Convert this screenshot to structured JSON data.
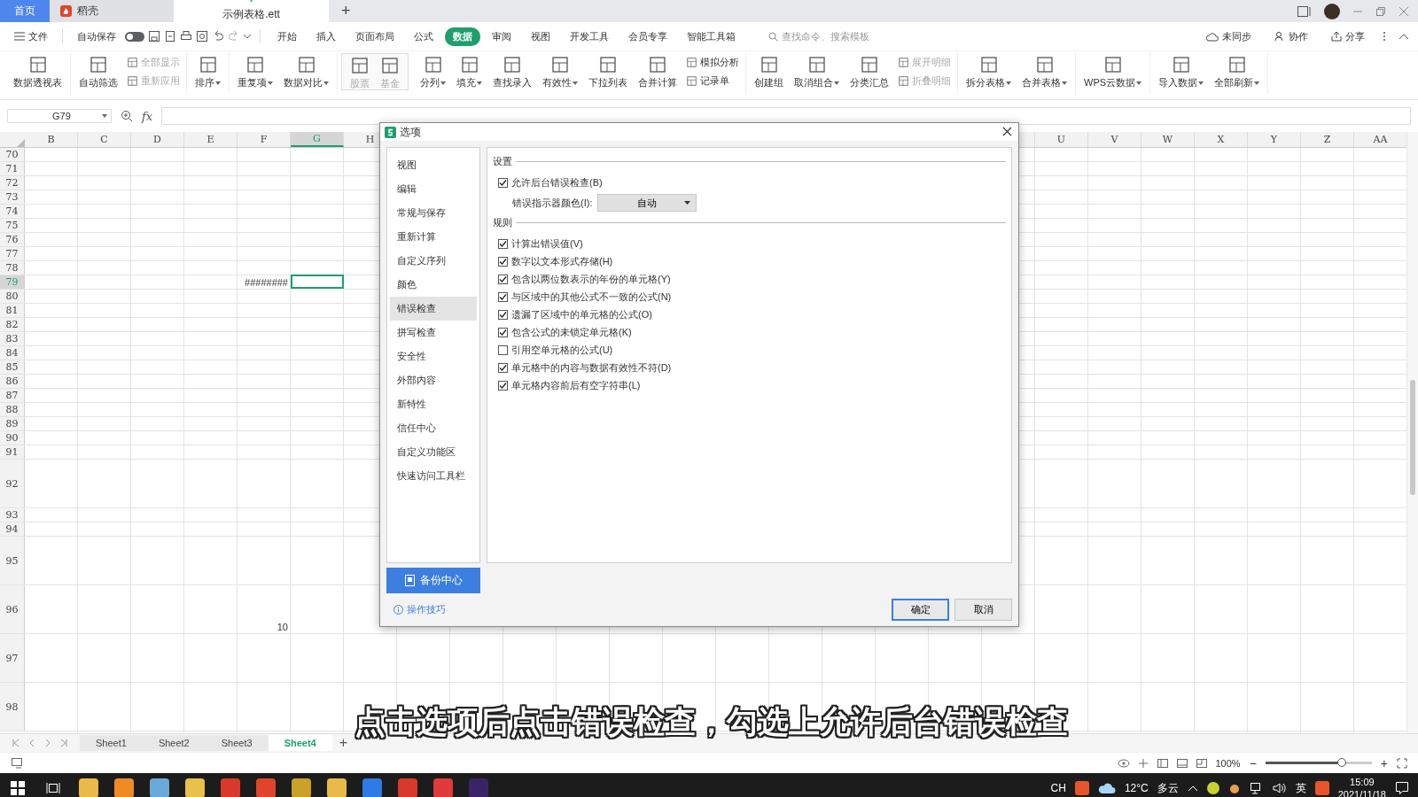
{
  "title_bar": {
    "tabs": [
      {
        "label": "首页",
        "kind": "home",
        "selected": false
      },
      {
        "label": "稻壳",
        "kind": "docer",
        "selected": false
      },
      {
        "label": "示例表格.ett",
        "kind": "sheet",
        "selected": true
      }
    ],
    "new_tab": "+"
  },
  "menu_bar": {
    "file": "文件",
    "autosave": {
      "label": "自动保存",
      "on": false
    },
    "tabs": [
      {
        "label": "开始",
        "selected": false
      },
      {
        "label": "插入",
        "selected": false
      },
      {
        "label": "页面布局",
        "selected": false
      },
      {
        "label": "公式",
        "selected": false
      },
      {
        "label": "数据",
        "selected": true
      },
      {
        "label": "审阅",
        "selected": false
      },
      {
        "label": "视图",
        "selected": false
      },
      {
        "label": "开发工具",
        "selected": false
      },
      {
        "label": "会员专享",
        "selected": false
      },
      {
        "label": "智能工具箱",
        "selected": false
      }
    ],
    "search": {
      "placeholder": "查找命令、搜索模板"
    },
    "actions": [
      "未同步",
      "协作",
      "分享"
    ]
  },
  "ribbon": {
    "groups": [
      {
        "kind": "plain",
        "items": [
          {
            "kind": "large",
            "label": "数据透视表",
            "dropdown": false,
            "disabled": false
          }
        ]
      },
      {
        "kind": "plain",
        "items": [
          {
            "kind": "large",
            "label": "自动筛选",
            "dropdown": false,
            "disabled": false
          },
          {
            "kind": "stack",
            "items": [
              {
                "label": "全部显示",
                "disabled": true
              },
              {
                "label": "重新应用",
                "disabled": true
              }
            ]
          }
        ]
      },
      {
        "kind": "plain",
        "items": [
          {
            "kind": "large",
            "label": "排序",
            "dropdown": true,
            "disabled": false
          }
        ]
      },
      {
        "kind": "plain",
        "items": [
          {
            "kind": "large",
            "label": "重复项",
            "dropdown": true,
            "disabled": false
          },
          {
            "kind": "large",
            "label": "数据对比",
            "dropdown": true,
            "disabled": false
          }
        ]
      },
      {
        "kind": "gallery",
        "items": [
          {
            "kind": "large",
            "label": "股票",
            "dropdown": false,
            "disabled": true
          },
          {
            "kind": "large",
            "label": "基金",
            "dropdown": false,
            "disabled": true
          }
        ]
      },
      {
        "kind": "plain",
        "items": [
          {
            "kind": "large",
            "label": "分列",
            "dropdown": true,
            "disabled": false
          },
          {
            "kind": "large",
            "label": "填充",
            "dropdown": true,
            "disabled": false
          },
          {
            "kind": "large",
            "label": "查找录入",
            "dropdown": false,
            "disabled": false
          },
          {
            "kind": "large",
            "label": "有效性",
            "dropdown": true,
            "disabled": false
          },
          {
            "kind": "large",
            "label": "下拉列表",
            "dropdown": false,
            "disabled": false
          },
          {
            "kind": "large",
            "label": "合并计算",
            "dropdown": false,
            "disabled": false
          },
          {
            "kind": "stack",
            "items": [
              {
                "label": "模拟分析",
                "disabled": false
              },
              {
                "label": "记录单",
                "disabled": false
              }
            ]
          }
        ]
      },
      {
        "kind": "plain",
        "items": [
          {
            "kind": "large",
            "label": "创建组",
            "dropdown": false,
            "disabled": false
          },
          {
            "kind": "large",
            "label": "取消组合",
            "dropdown": true,
            "disabled": false
          },
          {
            "kind": "large",
            "label": "分类汇总",
            "dropdown": false,
            "disabled": false
          },
          {
            "kind": "stack",
            "items": [
              {
                "label": "展开明细",
                "disabled": true
              },
              {
                "label": "折叠明细",
                "disabled": true
              }
            ]
          }
        ]
      },
      {
        "kind": "plain",
        "items": [
          {
            "kind": "large",
            "label": "拆分表格",
            "dropdown": true,
            "disabled": false
          },
          {
            "kind": "large",
            "label": "合并表格",
            "dropdown": true,
            "disabled": false
          }
        ]
      },
      {
        "kind": "plain",
        "items": [
          {
            "kind": "large",
            "label": "WPS云数据",
            "dropdown": true,
            "disabled": false
          }
        ]
      },
      {
        "kind": "plain",
        "items": [
          {
            "kind": "large",
            "label": "导入数据",
            "dropdown": true,
            "disabled": false
          },
          {
            "kind": "large",
            "label": "全部刷新",
            "dropdown": true,
            "disabled": false
          }
        ]
      }
    ]
  },
  "formula_bar": {
    "name_box": "G79",
    "function_label": "fx"
  },
  "grid": {
    "columns_left": [
      {
        "label": "B",
        "selected": false
      },
      {
        "label": "C",
        "selected": false
      },
      {
        "label": "D",
        "selected": false
      },
      {
        "label": "E",
        "selected": false
      },
      {
        "label": "F",
        "selected": false
      },
      {
        "label": "G",
        "selected": true
      },
      {
        "label": "H",
        "selected": false
      }
    ],
    "columns_right": [
      {
        "label": "U",
        "selected": false
      },
      {
        "label": "V",
        "selected": false
      },
      {
        "label": "W",
        "selected": false
      },
      {
        "label": "X",
        "selected": false
      },
      {
        "label": "Y",
        "selected": false
      },
      {
        "label": "Z",
        "selected": false
      },
      {
        "label": "AA",
        "selected": false
      }
    ],
    "rows": [
      {
        "label": "70",
        "selected": false
      },
      {
        "label": "71",
        "selected": false
      },
      {
        "label": "72",
        "selected": false
      },
      {
        "label": "73",
        "selected": false
      },
      {
        "label": "74",
        "selected": false
      },
      {
        "label": "75",
        "selected": false
      },
      {
        "label": "76",
        "selected": false
      },
      {
        "label": "77",
        "selected": false
      },
      {
        "label": "78",
        "selected": false
      },
      {
        "label": "79",
        "selected": true,
        "cells": [
          {
            "selected": false
          },
          {
            "selected": false
          },
          {
            "selected": false
          },
          {
            "selected": false
          },
          {
            "text": "########",
            "selected": false
          },
          {
            "selected": true
          }
        ]
      },
      {
        "label": "80",
        "selected": false
      },
      {
        "label": "81",
        "selected": false
      },
      {
        "label": "82",
        "selected": false
      },
      {
        "label": "83",
        "selected": false
      },
      {
        "label": "84",
        "selected": false
      },
      {
        "label": "85",
        "selected": false
      },
      {
        "label": "86",
        "selected": false
      },
      {
        "label": "87",
        "selected": false
      },
      {
        "label": "88",
        "selected": false
      },
      {
        "label": "89",
        "selected": false
      },
      {
        "label": "90",
        "selected": false
      },
      {
        "label": "91",
        "selected": false
      },
      {
        "label": "92",
        "selected": false
      },
      {
        "label": "93",
        "selected": false
      },
      {
        "label": "94",
        "selected": false
      },
      {
        "label": "95",
        "selected": false
      },
      {
        "label": "96",
        "selected": false,
        "cells": [
          {
            "selected": false
          },
          {
            "selected": false
          },
          {
            "selected": false
          },
          {
            "selected": false
          },
          {
            "text": "10",
            "selected": false
          }
        ]
      },
      {
        "label": "97",
        "selected": false
      },
      {
        "label": "98",
        "selected": false
      }
    ]
  },
  "dialog": {
    "title": "选项",
    "sidebar": [
      {
        "label": "视图",
        "selected": false
      },
      {
        "label": "编辑",
        "selected": false
      },
      {
        "label": "常规与保存",
        "selected": false
      },
      {
        "label": "重新计算",
        "selected": false
      },
      {
        "label": "自定义序列",
        "selected": false
      },
      {
        "label": "颜色",
        "selected": false
      },
      {
        "label": "错误检查",
        "selected": true
      },
      {
        "label": "拼写检查",
        "selected": false
      },
      {
        "label": "安全性",
        "selected": false
      },
      {
        "label": "外部内容",
        "selected": false
      },
      {
        "label": "新特性",
        "selected": false
      },
      {
        "label": "信任中心",
        "selected": false
      },
      {
        "label": "自定义功能区",
        "selected": false
      },
      {
        "label": "快速访问工具栏",
        "selected": false
      }
    ],
    "settings": {
      "heading": "设置",
      "background_check": {
        "label": "允许后台错误检查(B)",
        "checked": true
      },
      "indicator_color": {
        "label": "错误指示器颜色(I):",
        "value": "自动"
      }
    },
    "rules": {
      "heading": "规则",
      "items": [
        {
          "label": "计算出错误值(V)",
          "checked": true
        },
        {
          "label": "数字以文本形式存储(H)",
          "checked": true
        },
        {
          "label": "包含以两位数表示的年份的单元格(Y)",
          "checked": true
        },
        {
          "label": "与区域中的其他公式不一致的公式(N)",
          "checked": true
        },
        {
          "label": "遗漏了区域中的单元格的公式(O)",
          "checked": true
        },
        {
          "label": "包含公式的未锁定单元格(K)",
          "checked": true
        },
        {
          "label": "引用空单元格的公式(U)",
          "checked": false
        },
        {
          "label": "单元格中的内容与数据有效性不符(D)",
          "checked": true
        },
        {
          "label": "单元格内容前后有空字符串(L)",
          "checked": true
        }
      ]
    },
    "backup_button": "备份中心",
    "tips_link": "操作技巧",
    "ok_button": "确定",
    "cancel_button": "取消"
  },
  "sheet_tabs": {
    "tabs": [
      {
        "label": "Sheet1",
        "selected": false
      },
      {
        "label": "Sheet2",
        "selected": false
      },
      {
        "label": "Sheet3",
        "selected": false
      },
      {
        "label": "Sheet4",
        "selected": true
      }
    ],
    "add": "+"
  },
  "status_bar": {
    "zoom": "100%",
    "zoom_slider": {
      "level": 0.72
    },
    "minus": "−",
    "plus": "+"
  },
  "caption": "点击选项后点击错误检查，勾选上允许后台错误检查",
  "taskbar": {
    "input_mode": "CH",
    "weather": {
      "temperature": "12°C",
      "condition": "多云"
    },
    "ime": "英",
    "time": "15:09",
    "date": "2021/11/18"
  }
}
